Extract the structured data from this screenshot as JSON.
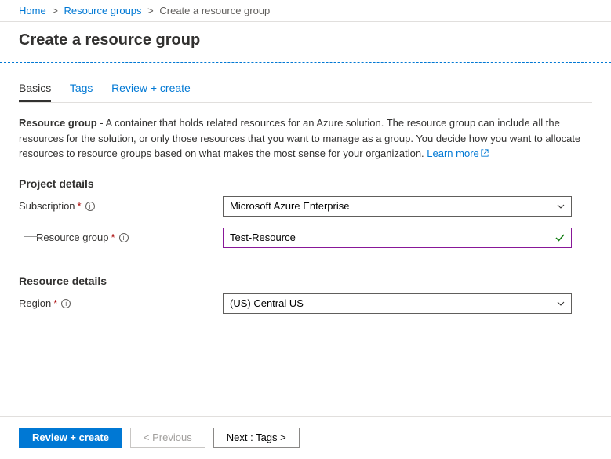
{
  "breadcrumb": {
    "items": [
      {
        "label": "Home",
        "link": true
      },
      {
        "label": "Resource groups",
        "link": true
      },
      {
        "label": "Create a resource group",
        "link": false
      }
    ]
  },
  "page": {
    "title": "Create a resource group"
  },
  "tabs": {
    "items": [
      {
        "label": "Basics",
        "active": true
      },
      {
        "label": "Tags",
        "active": false
      },
      {
        "label": "Review + create",
        "active": false
      }
    ]
  },
  "description": {
    "lead": "Resource group",
    "body": " - A container that holds related resources for an Azure solution. The resource group can include all the resources for the solution, or only those resources that you want to manage as a group. You decide how you want to allocate resources to resource groups based on what makes the most sense for your organization. ",
    "learn_more": "Learn more"
  },
  "sections": {
    "project": {
      "header": "Project details",
      "subscription_label": "Subscription",
      "subscription_value": "Microsoft Azure Enterprise",
      "rg_label": "Resource group",
      "rg_value": "Test-Resource"
    },
    "resource": {
      "header": "Resource details",
      "region_label": "Region",
      "region_value": "(US) Central US"
    }
  },
  "footer": {
    "review": "Review + create",
    "previous": "< Previous",
    "next": "Next : Tags >"
  }
}
